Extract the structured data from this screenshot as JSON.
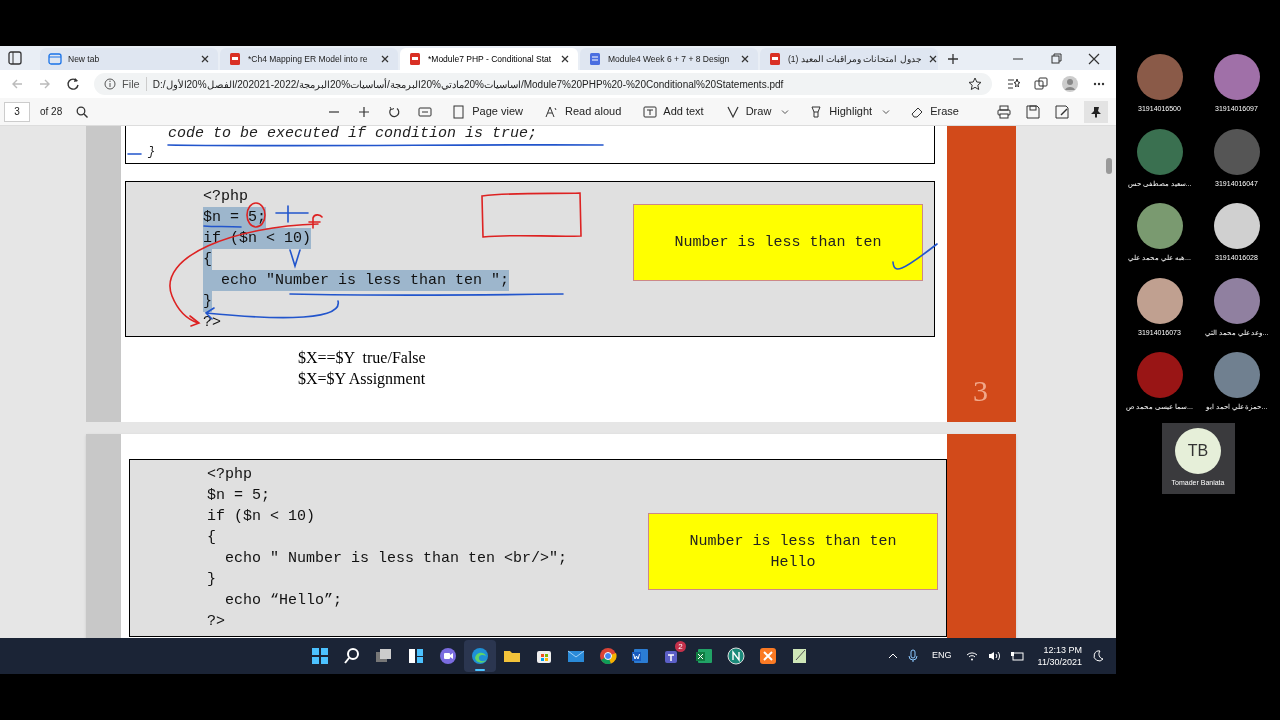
{
  "tabs": [
    {
      "kind": "newtab",
      "title": "New tab",
      "selected": false
    },
    {
      "kind": "pdf",
      "title": "*Ch4 Mapping ER Model into re",
      "selected": false
    },
    {
      "kind": "pdf",
      "title": "*Module7 PHP - Conditional Stat",
      "selected": true
    },
    {
      "kind": "doc",
      "title": "Module4 Week 6 + 7 + 8 Design",
      "selected": false
    },
    {
      "kind": "pdf",
      "title": "جدول امتحانات ومراقبات المعيد (1)",
      "selected": false
    }
  ],
  "address_bar": {
    "label": "File",
    "url": "D:/اساسيات%20مادتي%20البرمجة/أساسيات%20البرمجة/2022-202021/الفصل%20الأول/Module7%20PHP%20-%20Conditional%20Statements.pdf"
  },
  "pdf_toolbar": {
    "page": "3",
    "page_count": "of 28",
    "buttons": [
      {
        "kind": "pageview",
        "label": "Page view"
      },
      {
        "kind": "read",
        "label": "Read aloud"
      },
      {
        "kind": "addtext",
        "label": "Add text"
      },
      {
        "kind": "draw",
        "label": "Draw"
      },
      {
        "kind": "highlight",
        "label": "Highlight"
      },
      {
        "kind": "erase",
        "label": "Erase"
      }
    ]
  },
  "slide_1": {
    "top_box_lines": [
      "code to be executed if condition is true;",
      "}"
    ],
    "code_lines": [
      {
        "text": "<?php",
        "highlighted": false
      },
      {
        "text": "$n = 5;",
        "highlighted": true
      },
      {
        "text": "if ($n < 10)",
        "highlighted": true
      },
      {
        "text": "{",
        "highlighted": true
      },
      {
        "text": "  echo \"Number is less than ten \";",
        "highlighted": true
      },
      {
        "text": "}",
        "highlighted": true
      },
      {
        "text": "?>",
        "highlighted": false
      }
    ],
    "output_lines": [
      "Number is less than ten"
    ],
    "notes": [
      "$X==$Y  true/False",
      "$X=$Y Assignment"
    ],
    "page_number": "3"
  },
  "slide_2": {
    "code_lines": [
      {
        "text": "<?php",
        "highlighted": false
      },
      {
        "text": "$n = 5;",
        "highlighted": false
      },
      {
        "text": "if ($n < 10)",
        "highlighted": false
      },
      {
        "text": "{",
        "highlighted": false
      },
      {
        "text": "  echo \" Number is less than ten <br/>\";",
        "highlighted": false
      },
      {
        "text": "}",
        "highlighted": false
      },
      {
        "text": "  echo “Hello”;",
        "highlighted": false
      },
      {
        "text": "?>",
        "highlighted": false
      }
    ],
    "output_lines": [
      "Number is less than ten",
      "Hello"
    ]
  },
  "participants": [
    {
      "name": "31914016500"
    },
    {
      "name": "31914016097"
    },
    {
      "name": "...سعيد مصطفى حس"
    },
    {
      "name": "31914016047"
    },
    {
      "name": "...هبه علي محمد علي"
    },
    {
      "name": "31914016028"
    },
    {
      "name": "31914016073"
    },
    {
      "name": "...وعد علي محمد الثي"
    },
    {
      "name": "...سما عيسى محمد ص"
    },
    {
      "name": "...حمزة علي احمد ابو"
    }
  ],
  "self_tile": {
    "initials": "TB",
    "name": "Tomader Baniata"
  },
  "taskbar": {
    "apps": [
      {
        "kind": "start",
        "active": false
      },
      {
        "kind": "search",
        "active": false
      },
      {
        "kind": "taskview",
        "active": false
      },
      {
        "kind": "widgets",
        "active": false
      },
      {
        "kind": "chat",
        "active": false
      },
      {
        "kind": "edge",
        "active": true
      },
      {
        "kind": "explorer",
        "active": false
      },
      {
        "kind": "store",
        "active": false
      },
      {
        "kind": "mail",
        "active": false
      },
      {
        "kind": "chrome",
        "active": false
      },
      {
        "kind": "word",
        "active": false
      },
      {
        "kind": "teams",
        "active": false,
        "badge": "2"
      },
      {
        "kind": "excel",
        "active": false
      },
      {
        "kind": "netbeans",
        "active": false
      },
      {
        "kind": "xampp",
        "active": false
      },
      {
        "kind": "notepad",
        "active": false
      }
    ],
    "language": "ENG",
    "time": "12:13 PM",
    "date": "11/30/2021"
  }
}
